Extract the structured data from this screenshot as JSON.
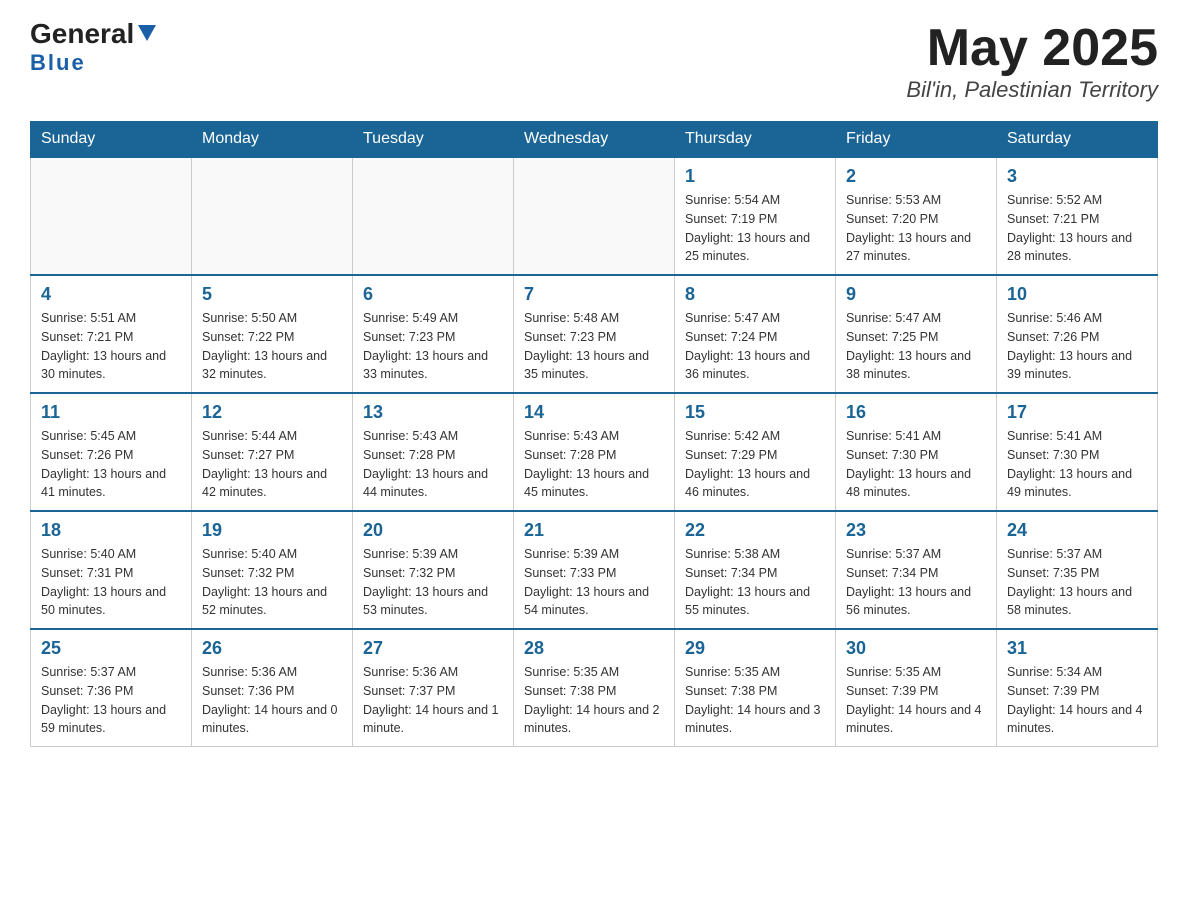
{
  "header": {
    "logo_general": "General",
    "logo_blue": "Blue",
    "month_title": "May 2025",
    "subtitle": "Bil'in, Palestinian Territory"
  },
  "days_of_week": [
    "Sunday",
    "Monday",
    "Tuesday",
    "Wednesday",
    "Thursday",
    "Friday",
    "Saturday"
  ],
  "weeks": [
    [
      {
        "day": "",
        "info": ""
      },
      {
        "day": "",
        "info": ""
      },
      {
        "day": "",
        "info": ""
      },
      {
        "day": "",
        "info": ""
      },
      {
        "day": "1",
        "info": "Sunrise: 5:54 AM\nSunset: 7:19 PM\nDaylight: 13 hours and 25 minutes."
      },
      {
        "day": "2",
        "info": "Sunrise: 5:53 AM\nSunset: 7:20 PM\nDaylight: 13 hours and 27 minutes."
      },
      {
        "day": "3",
        "info": "Sunrise: 5:52 AM\nSunset: 7:21 PM\nDaylight: 13 hours and 28 minutes."
      }
    ],
    [
      {
        "day": "4",
        "info": "Sunrise: 5:51 AM\nSunset: 7:21 PM\nDaylight: 13 hours and 30 minutes."
      },
      {
        "day": "5",
        "info": "Sunrise: 5:50 AM\nSunset: 7:22 PM\nDaylight: 13 hours and 32 minutes."
      },
      {
        "day": "6",
        "info": "Sunrise: 5:49 AM\nSunset: 7:23 PM\nDaylight: 13 hours and 33 minutes."
      },
      {
        "day": "7",
        "info": "Sunrise: 5:48 AM\nSunset: 7:23 PM\nDaylight: 13 hours and 35 minutes."
      },
      {
        "day": "8",
        "info": "Sunrise: 5:47 AM\nSunset: 7:24 PM\nDaylight: 13 hours and 36 minutes."
      },
      {
        "day": "9",
        "info": "Sunrise: 5:47 AM\nSunset: 7:25 PM\nDaylight: 13 hours and 38 minutes."
      },
      {
        "day": "10",
        "info": "Sunrise: 5:46 AM\nSunset: 7:26 PM\nDaylight: 13 hours and 39 minutes."
      }
    ],
    [
      {
        "day": "11",
        "info": "Sunrise: 5:45 AM\nSunset: 7:26 PM\nDaylight: 13 hours and 41 minutes."
      },
      {
        "day": "12",
        "info": "Sunrise: 5:44 AM\nSunset: 7:27 PM\nDaylight: 13 hours and 42 minutes."
      },
      {
        "day": "13",
        "info": "Sunrise: 5:43 AM\nSunset: 7:28 PM\nDaylight: 13 hours and 44 minutes."
      },
      {
        "day": "14",
        "info": "Sunrise: 5:43 AM\nSunset: 7:28 PM\nDaylight: 13 hours and 45 minutes."
      },
      {
        "day": "15",
        "info": "Sunrise: 5:42 AM\nSunset: 7:29 PM\nDaylight: 13 hours and 46 minutes."
      },
      {
        "day": "16",
        "info": "Sunrise: 5:41 AM\nSunset: 7:30 PM\nDaylight: 13 hours and 48 minutes."
      },
      {
        "day": "17",
        "info": "Sunrise: 5:41 AM\nSunset: 7:30 PM\nDaylight: 13 hours and 49 minutes."
      }
    ],
    [
      {
        "day": "18",
        "info": "Sunrise: 5:40 AM\nSunset: 7:31 PM\nDaylight: 13 hours and 50 minutes."
      },
      {
        "day": "19",
        "info": "Sunrise: 5:40 AM\nSunset: 7:32 PM\nDaylight: 13 hours and 52 minutes."
      },
      {
        "day": "20",
        "info": "Sunrise: 5:39 AM\nSunset: 7:32 PM\nDaylight: 13 hours and 53 minutes."
      },
      {
        "day": "21",
        "info": "Sunrise: 5:39 AM\nSunset: 7:33 PM\nDaylight: 13 hours and 54 minutes."
      },
      {
        "day": "22",
        "info": "Sunrise: 5:38 AM\nSunset: 7:34 PM\nDaylight: 13 hours and 55 minutes."
      },
      {
        "day": "23",
        "info": "Sunrise: 5:37 AM\nSunset: 7:34 PM\nDaylight: 13 hours and 56 minutes."
      },
      {
        "day": "24",
        "info": "Sunrise: 5:37 AM\nSunset: 7:35 PM\nDaylight: 13 hours and 58 minutes."
      }
    ],
    [
      {
        "day": "25",
        "info": "Sunrise: 5:37 AM\nSunset: 7:36 PM\nDaylight: 13 hours and 59 minutes."
      },
      {
        "day": "26",
        "info": "Sunrise: 5:36 AM\nSunset: 7:36 PM\nDaylight: 14 hours and 0 minutes."
      },
      {
        "day": "27",
        "info": "Sunrise: 5:36 AM\nSunset: 7:37 PM\nDaylight: 14 hours and 1 minute."
      },
      {
        "day": "28",
        "info": "Sunrise: 5:35 AM\nSunset: 7:38 PM\nDaylight: 14 hours and 2 minutes."
      },
      {
        "day": "29",
        "info": "Sunrise: 5:35 AM\nSunset: 7:38 PM\nDaylight: 14 hours and 3 minutes."
      },
      {
        "day": "30",
        "info": "Sunrise: 5:35 AM\nSunset: 7:39 PM\nDaylight: 14 hours and 4 minutes."
      },
      {
        "day": "31",
        "info": "Sunrise: 5:34 AM\nSunset: 7:39 PM\nDaylight: 14 hours and 4 minutes."
      }
    ]
  ]
}
